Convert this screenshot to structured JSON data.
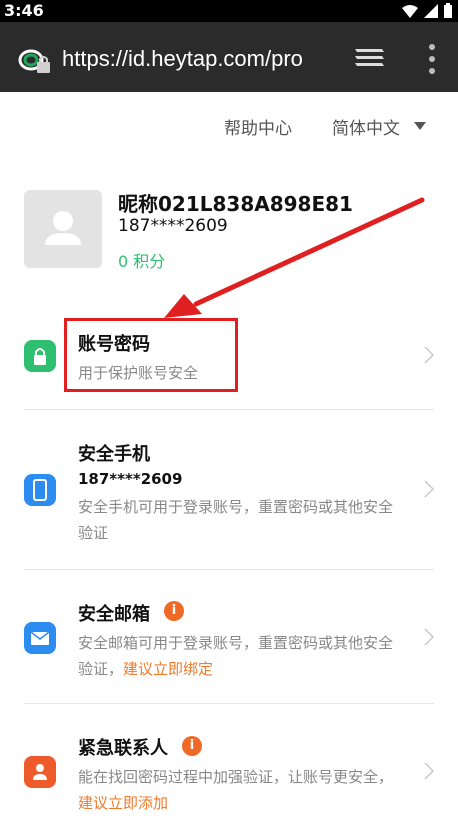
{
  "status_bar": {
    "time": "3:46"
  },
  "browser": {
    "url": "https://id.heytap.com/pro"
  },
  "top_links": {
    "help": "帮助中心",
    "language": "简体中文"
  },
  "profile": {
    "nickname": "昵称021L838A898E81",
    "phone": "187****2609",
    "points": "0 积分"
  },
  "security_items": [
    {
      "title": "账号密码",
      "subtitle": "用于保护账号安全"
    },
    {
      "title": "安全手机",
      "value": "187****2609",
      "subtitle": "安全手机可用于登录账号，重置密码或其他安全验证"
    },
    {
      "title": "安全邮箱",
      "subtitle": "安全邮箱可用于登录账号，重置密码或其他安全验证，",
      "suggestion": "建议立即绑定"
    },
    {
      "title": "紧急联系人",
      "subtitle": "能在找回密码过程中加强验证，让账号更安全，",
      "suggestion": "建议立即添加"
    }
  ],
  "colors": {
    "accent_green": "#2fbf71",
    "suggest_orange": "#ef7a2b",
    "highlight_red": "#e02020",
    "password_icon": "#2fbf71",
    "phone_icon": "#2d8cf0",
    "email_icon": "#2d8cf0",
    "contact_icon": "#ef5a2b"
  }
}
